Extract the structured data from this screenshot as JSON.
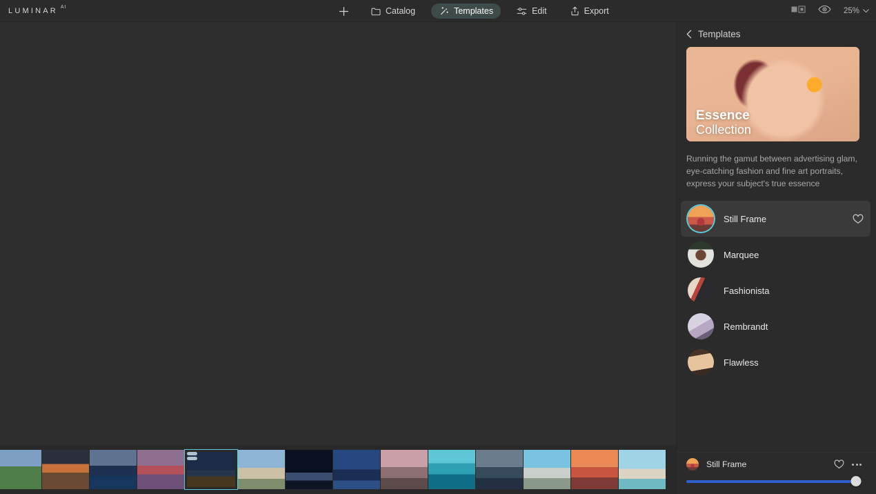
{
  "app": {
    "brand_word": "LUMINAR",
    "brand_suffix": "AI",
    "accent_color": "#5fc8d8",
    "slider_color": "#2e5fd0",
    "panel_bg": "#2b2b2b",
    "canvas_bg": "#2e2e2e"
  },
  "toolbar": {
    "add_label": "",
    "items": [
      {
        "label": "Catalog",
        "icon": "folder-icon",
        "active": false
      },
      {
        "label": "Templates",
        "icon": "magic-wand-icon",
        "active": true
      },
      {
        "label": "Edit",
        "icon": "sliders-icon",
        "active": false
      },
      {
        "label": "Export",
        "icon": "share-upload-icon",
        "active": false
      }
    ],
    "compare_icon": "compare-split-icon",
    "preview_icon": "eye-icon",
    "zoom_value": "25%",
    "zoom_chevron": "chevron-down-icon"
  },
  "panel": {
    "back_icon": "chevron-left-icon",
    "title": "Templates",
    "hero": {
      "title_line1": "Essence",
      "title_line2": "Collection"
    },
    "description": "Running the gamut between advertising glam, eye-catching fashion and fine art portraits, express your subject's true essence",
    "templates": [
      {
        "name": "Still Frame",
        "selected": true,
        "favorite_icon": "heart-icon",
        "avatar_class": "av1"
      },
      {
        "name": "Marquee",
        "selected": false,
        "favorite_icon": "heart-icon",
        "avatar_class": "av2"
      },
      {
        "name": "Fashionista",
        "selected": false,
        "favorite_icon": "heart-icon",
        "avatar_class": "av3"
      },
      {
        "name": "Rembrandt",
        "selected": false,
        "favorite_icon": "heart-icon",
        "avatar_class": "av4"
      },
      {
        "name": "Flawless",
        "selected": false,
        "favorite_icon": "heart-icon",
        "avatar_class": "av5"
      }
    ]
  },
  "bottom_panel": {
    "template_name": "Still Frame",
    "favorite_icon": "heart-icon",
    "more_icon": "more-options-icon",
    "amount_percent": 97
  },
  "filmstrip": {
    "selected_index": 4,
    "thumbnails": [
      {
        "art": "a1",
        "selected": false,
        "badges": 0
      },
      {
        "art": "a2",
        "selected": false,
        "badges": 0
      },
      {
        "art": "a3",
        "selected": false,
        "badges": 0
      },
      {
        "art": "a4",
        "selected": false,
        "badges": 0
      },
      {
        "art": "a5",
        "selected": true,
        "badges": 2
      },
      {
        "art": "a6",
        "selected": false,
        "badges": 0
      },
      {
        "art": "a7",
        "selected": false,
        "badges": 0
      },
      {
        "art": "a8",
        "selected": false,
        "badges": 0
      },
      {
        "art": "a9",
        "selected": false,
        "badges": 0
      },
      {
        "art": "a10",
        "selected": false,
        "badges": 0
      },
      {
        "art": "a11",
        "selected": false,
        "badges": 0
      },
      {
        "art": "a12",
        "selected": false,
        "badges": 0
      },
      {
        "art": "a13",
        "selected": false,
        "badges": 0
      },
      {
        "art": "a14",
        "selected": false,
        "badges": 0
      }
    ]
  }
}
